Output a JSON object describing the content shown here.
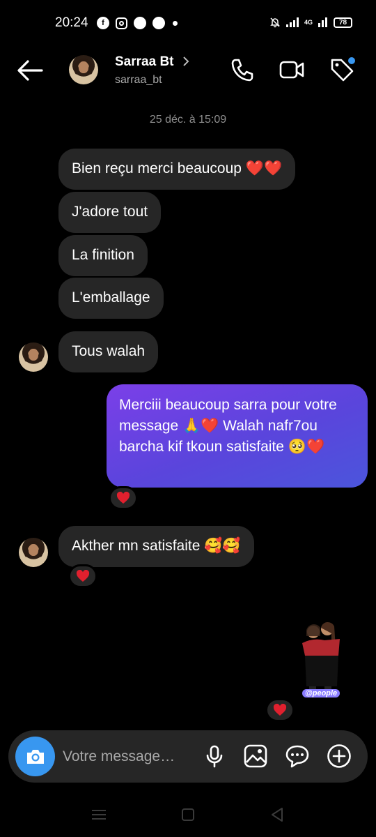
{
  "status_bar": {
    "time": "20:24",
    "app_icons": [
      "facebook-icon",
      "instagram-icon",
      "messages-icon",
      "messenger-icon"
    ],
    "network": "4G",
    "battery": "78"
  },
  "header": {
    "contact_name": "Sarraa Bt",
    "handle": "sarraa_bt",
    "accent_color": "#3897f0"
  },
  "conversation": {
    "timestamp": "25 déc. à 15:09",
    "incoming_messages": [
      "Bien reçu merci beaucoup ❤️❤️",
      "J'adore tout",
      "La finition",
      "L'emballage",
      "Tous walah"
    ],
    "outgoing_message": "Merciii beaucoup sarra pour votre message 🙏❤️ Walah nafr7ou barcha kif tkoun satisfaite 🥺❤️",
    "reply_message": "Akther mn satisfaite 🥰🥰",
    "reaction": "heart",
    "sticker_label": "@people",
    "outgoing_gradient": [
      "#7b3fe8",
      "#4b55dc"
    ]
  },
  "composer": {
    "placeholder": "Votre message…"
  }
}
